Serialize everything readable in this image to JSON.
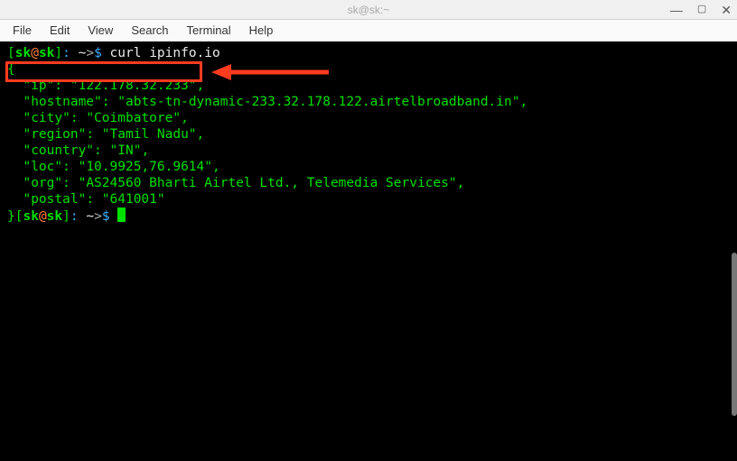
{
  "window": {
    "title": "sk@sk:~"
  },
  "menu": {
    "file": "File",
    "edit": "Edit",
    "view": "View",
    "search": "Search",
    "terminal": "Terminal",
    "help": "Help"
  },
  "prompt": {
    "user": "sk",
    "host": "sk",
    "path": "~",
    "arrow": ">",
    "dollar": "$"
  },
  "command": "curl ipinfo.io",
  "json_open": "{",
  "json_close": "}",
  "output": {
    "ip": {
      "key": "\"ip\"",
      "value": "\"122.178.32.233\""
    },
    "hostname": {
      "key": "\"hostname\"",
      "value": "\"abts-tn-dynamic-233.32.178.122.airtelbroadband.in\""
    },
    "city": {
      "key": "\"city\"",
      "value": "\"Coimbatore\""
    },
    "region": {
      "key": "\"region\"",
      "value": "\"Tamil Nadu\""
    },
    "country": {
      "key": "\"country\"",
      "value": "\"IN\""
    },
    "loc": {
      "key": "\"loc\"",
      "value": "\"10.9925,76.9614\""
    },
    "org": {
      "key": "\"org\"",
      "value": "\"AS24560 Bharti Airtel Ltd., Telemedia Services\""
    },
    "postal": {
      "key": "\"postal\"",
      "value": "\"641001\""
    }
  }
}
